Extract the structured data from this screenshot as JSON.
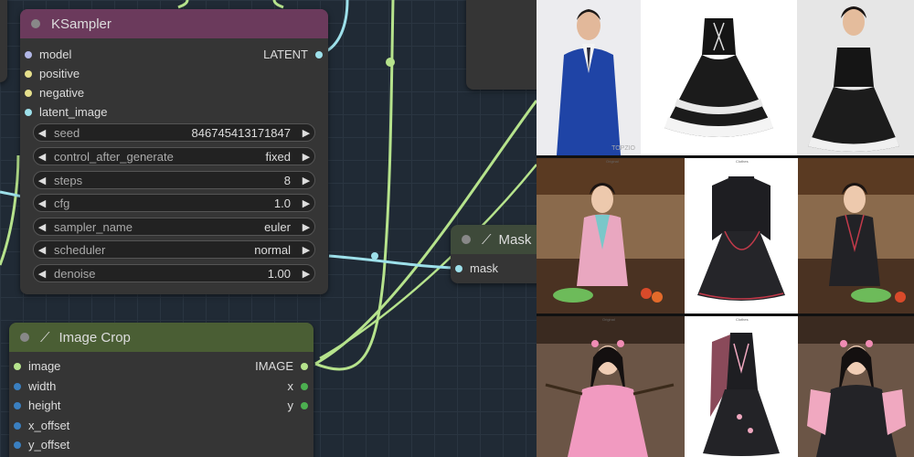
{
  "ksampler": {
    "title": "KSampler",
    "inputs": [
      "model",
      "positive",
      "negative",
      "latent_image"
    ],
    "output": "LATENT",
    "widgets": [
      {
        "name": "seed",
        "value": "846745413171847"
      },
      {
        "name": "control_after_generate",
        "value": "fixed"
      },
      {
        "name": "steps",
        "value": "8"
      },
      {
        "name": "cfg",
        "value": "1.0"
      },
      {
        "name": "sampler_name",
        "value": "euler"
      },
      {
        "name": "scheduler",
        "value": "normal"
      },
      {
        "name": "denoise",
        "value": "1.00"
      }
    ]
  },
  "mask_node": {
    "title": "Mask",
    "input": "mask"
  },
  "image_crop": {
    "title": "Image Crop",
    "inputs": [
      "image",
      "width",
      "height",
      "x_offset",
      "y_offset"
    ],
    "outputs": [
      "IMAGE",
      "x",
      "y"
    ]
  },
  "gallery": {
    "watermark": "TOPZIO",
    "captions": [
      "Original",
      "Clothes",
      "Original",
      "Clothes"
    ]
  },
  "colors": {
    "ksampler_header": "#6b3a5c",
    "mask_header": "#3e4a3a",
    "crop_header": "#4a5e34",
    "wire_green": "#b6e38c",
    "wire_cyan": "#9de0ea"
  }
}
